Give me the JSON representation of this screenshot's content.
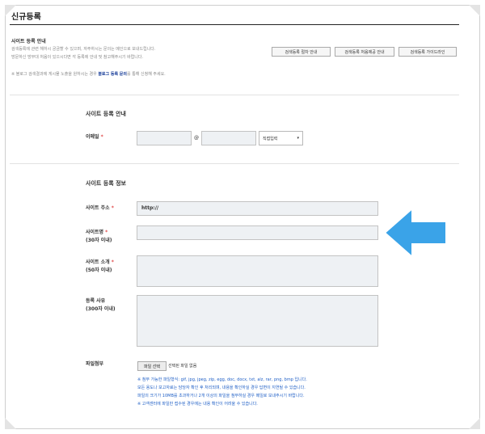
{
  "header": {
    "title": "신규등록"
  },
  "guide": {
    "title": "사이트 등록 안내",
    "lines": [
      "검색등록에 관련 해하시 궁금할 수 있으며, 자주하시는 문의는 메인으로 보내드립니다.",
      "방문하신 방무대 처음이 있으시다면 각 등록에 안내 및 참고해주시기 바랍니다."
    ],
    "buttons": [
      "검색등록 절차 안내",
      "검색등록 처음제공 안내",
      "검색등록 가이드라인"
    ]
  },
  "notice": {
    "prefix": "※ 블로그 검색결과에 게시물 노출을 원하시는 경우 ",
    "link": "블로그 등록 문의",
    "suffix": "를 통해 신청해 주세요."
  },
  "section1": {
    "title": "사이트 등록 안내",
    "email_label": "이메일",
    "required_mark": "*",
    "at_sign": "@",
    "domain_select": "직접입력",
    "select_arrow": "▾"
  },
  "section2": {
    "title": "사이트 등록 정보",
    "url": {
      "label": "사이트 주소",
      "value": "http://"
    },
    "name": {
      "label": "사이트명",
      "limit": "(30자 이내)"
    },
    "intro": {
      "label": "사이트 소개",
      "limit": "(50자 이내)"
    },
    "reason": {
      "label": "등록 사유",
      "limit": "(300자 이내)"
    },
    "file": {
      "label": "파일첨부",
      "button": "파일 선택",
      "status": "선택된 파일 없음",
      "notes": [
        "※ 첨부 가능한 파일형식: gif, jpg, jpeg, zip, egg, doc, docx, txt, alz, rar, png, bmp 입니다.",
        "모든 용도나 보고자료는 담당자 확인 후 처리되며, 내용을 확인하실 경우 답변이 지연될 수 있습니다.",
        "파일의 크기가 10MB를 초과하거나 2개 이상의 파일을 첨부하실 경우 메일로 보내주시기 바랍니다.",
        "※ 고객센터에 파일만 접수된 경우에는 내용 확인이 어려울 수 있습니다."
      ]
    }
  },
  "arrow": {
    "color": "#3aa3e8"
  }
}
